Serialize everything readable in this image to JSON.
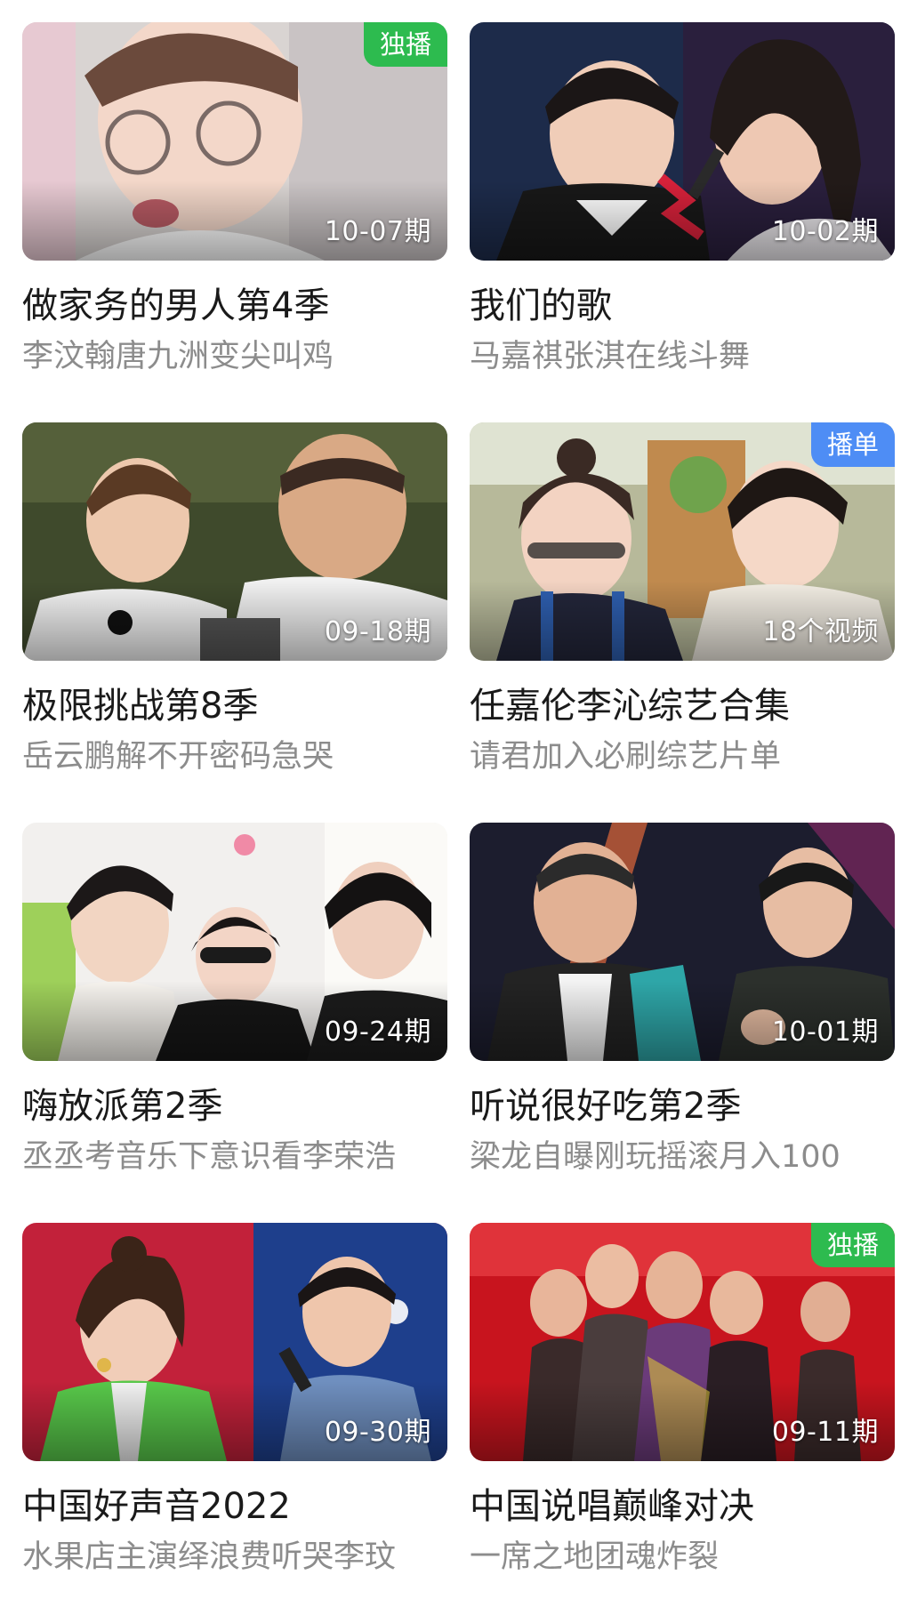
{
  "cards": [
    {
      "title": "做家务的男人第4季",
      "subtitle": "李汶翰唐九洲变尖叫鸡",
      "episode": "10-07期",
      "tag": "独播",
      "tag_color": "#2dbb4f"
    },
    {
      "title": "我们的歌",
      "subtitle": "马嘉祺张淇在线斗舞",
      "episode": "10-02期",
      "tag": "",
      "tag_color": ""
    },
    {
      "title": "极限挑战第8季",
      "subtitle": "岳云鹏解不开密码急哭",
      "episode": "09-18期",
      "tag": "",
      "tag_color": ""
    },
    {
      "title": "任嘉伦李沁综艺合集",
      "subtitle": "请君加入必刷综艺片单",
      "episode": "18个视频",
      "tag": "播单",
      "tag_color": "#4e8df5"
    },
    {
      "title": "嗨放派第2季",
      "subtitle": "丞丞考音乐下意识看李荣浩",
      "episode": "09-24期",
      "tag": "",
      "tag_color": ""
    },
    {
      "title": "听说很好吃第2季",
      "subtitle": "梁龙自曝刚玩摇滚月入100",
      "episode": "10-01期",
      "tag": "",
      "tag_color": ""
    },
    {
      "title": "中国好声音2022",
      "subtitle": "水果店主演绎浪费听哭李玟",
      "episode": "09-30期",
      "tag": "",
      "tag_color": ""
    },
    {
      "title": "中国说唱巅峰对决",
      "subtitle": "一席之地团魂炸裂",
      "episode": "09-11期",
      "tag": "独播",
      "tag_color": "#2dbb4f"
    }
  ]
}
